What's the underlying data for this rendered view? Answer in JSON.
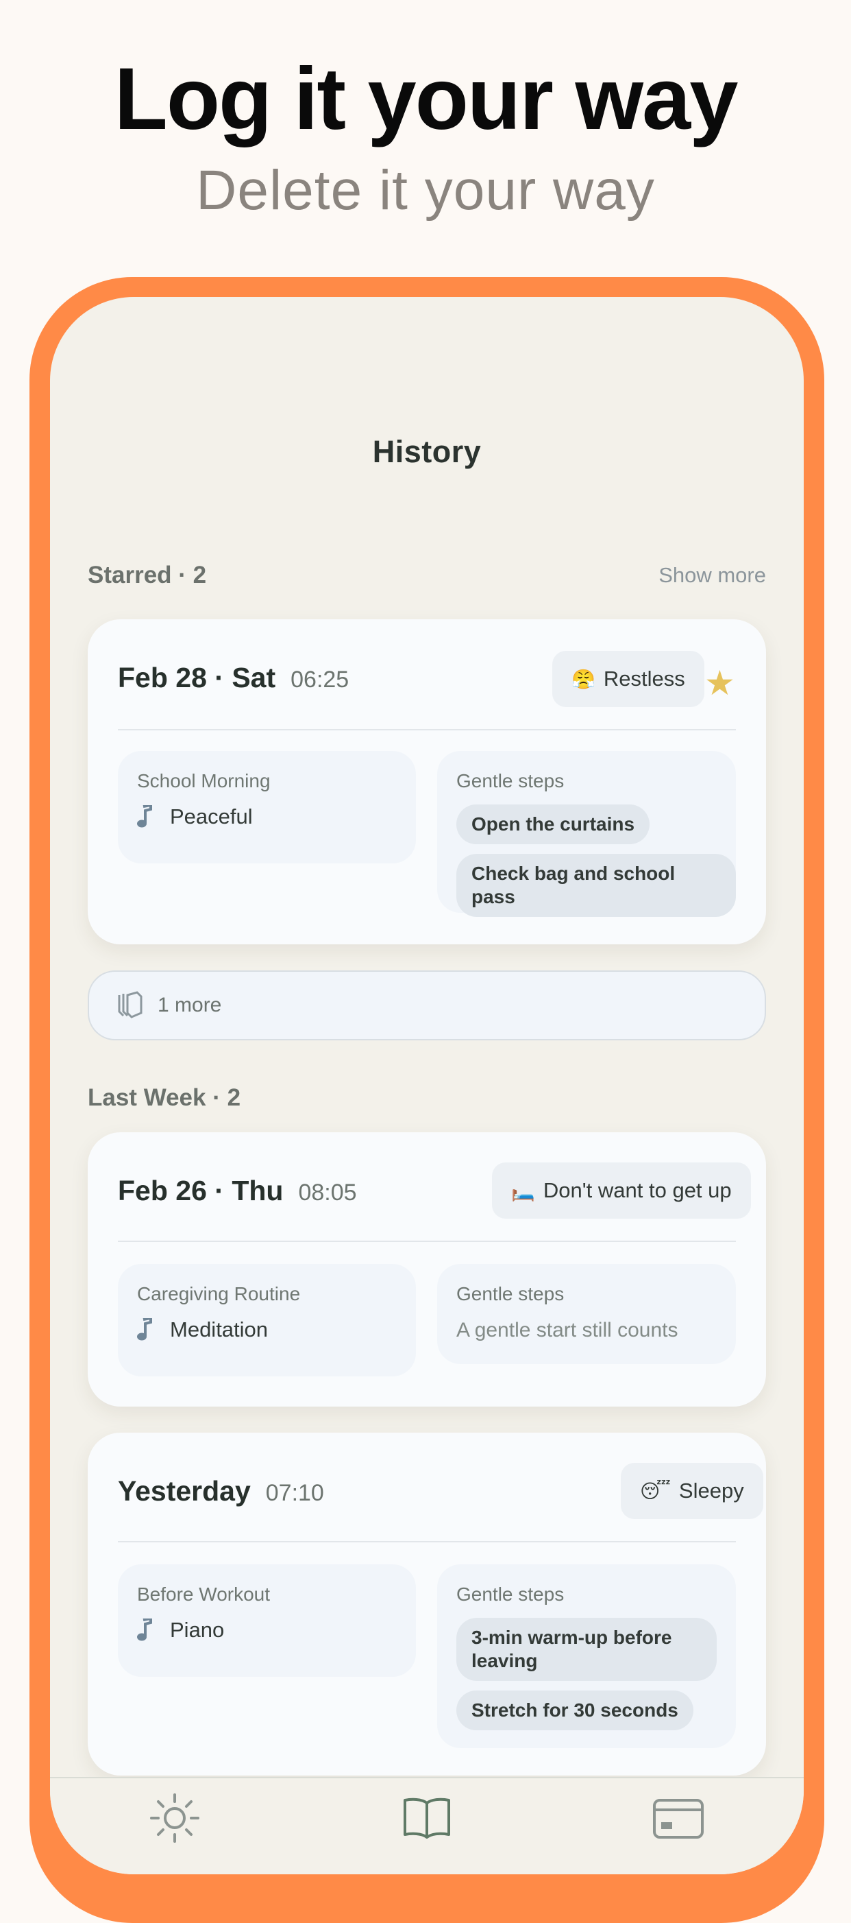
{
  "marketing": {
    "headline": "Log it your way",
    "subline": "Delete it your way"
  },
  "nav": {
    "title": "History"
  },
  "starred_section": {
    "title": "Starred · 2",
    "show_more": "Show more",
    "entry": {
      "date": "Feb 28 · Sat",
      "time": "06:25",
      "mood_emoji": "😤",
      "mood": "Restless",
      "starred": true,
      "routine_name": "School Morning",
      "music": "Peaceful",
      "steps_label": "Gentle steps",
      "steps": [
        "Open the curtains",
        "Check bag and school pass"
      ]
    },
    "more_label": "1 more"
  },
  "last_week_section": {
    "title": "Last Week · 2",
    "entries": [
      {
        "date": "Feb 26 · Thu",
        "time": "08:05",
        "mood_emoji": "🛏️",
        "mood": "Don't want to get up",
        "routine_name": "Caregiving Routine",
        "music": "Meditation",
        "steps_label": "Gentle steps",
        "steps_empty": "A gentle start still counts"
      },
      {
        "date": "Yesterday",
        "time": "07:10",
        "mood_emoji": "😴",
        "mood": "Sleepy",
        "routine_name": "Before Workout",
        "music": "Piano",
        "steps_label": "Gentle steps",
        "steps": [
          "3-min warm-up before leaving",
          "Stretch for 30 seconds"
        ]
      }
    ]
  },
  "tab_bar": {
    "tabs": [
      {
        "icon": "sun-icon"
      },
      {
        "icon": "book-icon",
        "active": true
      },
      {
        "icon": "card-icon"
      }
    ]
  },
  "colors": {
    "frame": "#ff8a47",
    "screen_bg": "#f3f1ea",
    "card_bg": "#f9fbfd",
    "star": "#e6c25c",
    "tab_active": "#5f7a66",
    "tab_inactive": "#8c9490"
  }
}
